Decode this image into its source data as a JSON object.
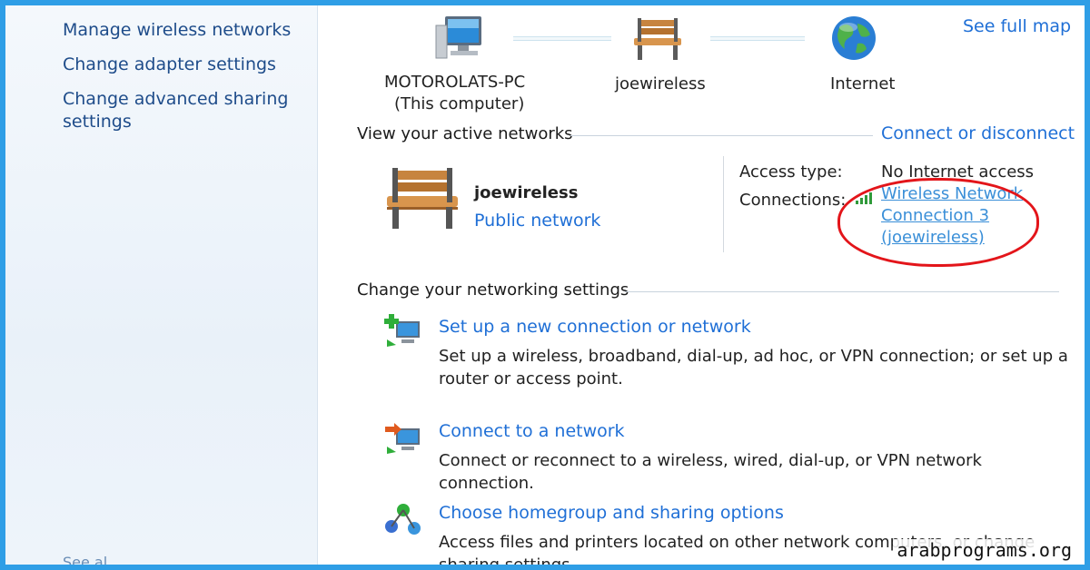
{
  "sidebar": {
    "items": [
      {
        "label": "Manage wireless networks"
      },
      {
        "label": "Change adapter settings"
      },
      {
        "label": "Change advanced sharing settings"
      }
    ],
    "cut_label": "See al"
  },
  "map": {
    "see_full_map": "See full map",
    "computer_name": "MOTOROLATS-PC",
    "computer_sub": "(This computer)",
    "network_name": "joewireless",
    "internet": "Internet"
  },
  "active": {
    "header": "View your active networks",
    "connect_link": "Connect or disconnect",
    "network_name": "joewireless",
    "network_type": "Public network",
    "access_label": "Access type:",
    "access_value": "No Internet access",
    "connections_label": "Connections:",
    "connection_line1": "Wireless Network",
    "connection_line2": "Connection 3",
    "connection_line3": "(joewireless)"
  },
  "settings": {
    "header": "Change your networking settings",
    "tasks": [
      {
        "title": "Set up a new connection or network",
        "desc": "Set up a wireless, broadband, dial-up, ad hoc, or VPN connection; or set up a router or access point."
      },
      {
        "title": "Connect to a network",
        "desc": "Connect or reconnect to a wireless, wired, dial-up, or VPN network connection."
      },
      {
        "title": "Choose homegroup and sharing options",
        "desc": "Access files and printers located on other network computers, or change sharing settings."
      }
    ]
  },
  "watermark": "arabprograms.org",
  "colors": {
    "link": "#1f6fd6",
    "highlight_circle": "#e3151a",
    "frame": "#2f9ee6"
  }
}
